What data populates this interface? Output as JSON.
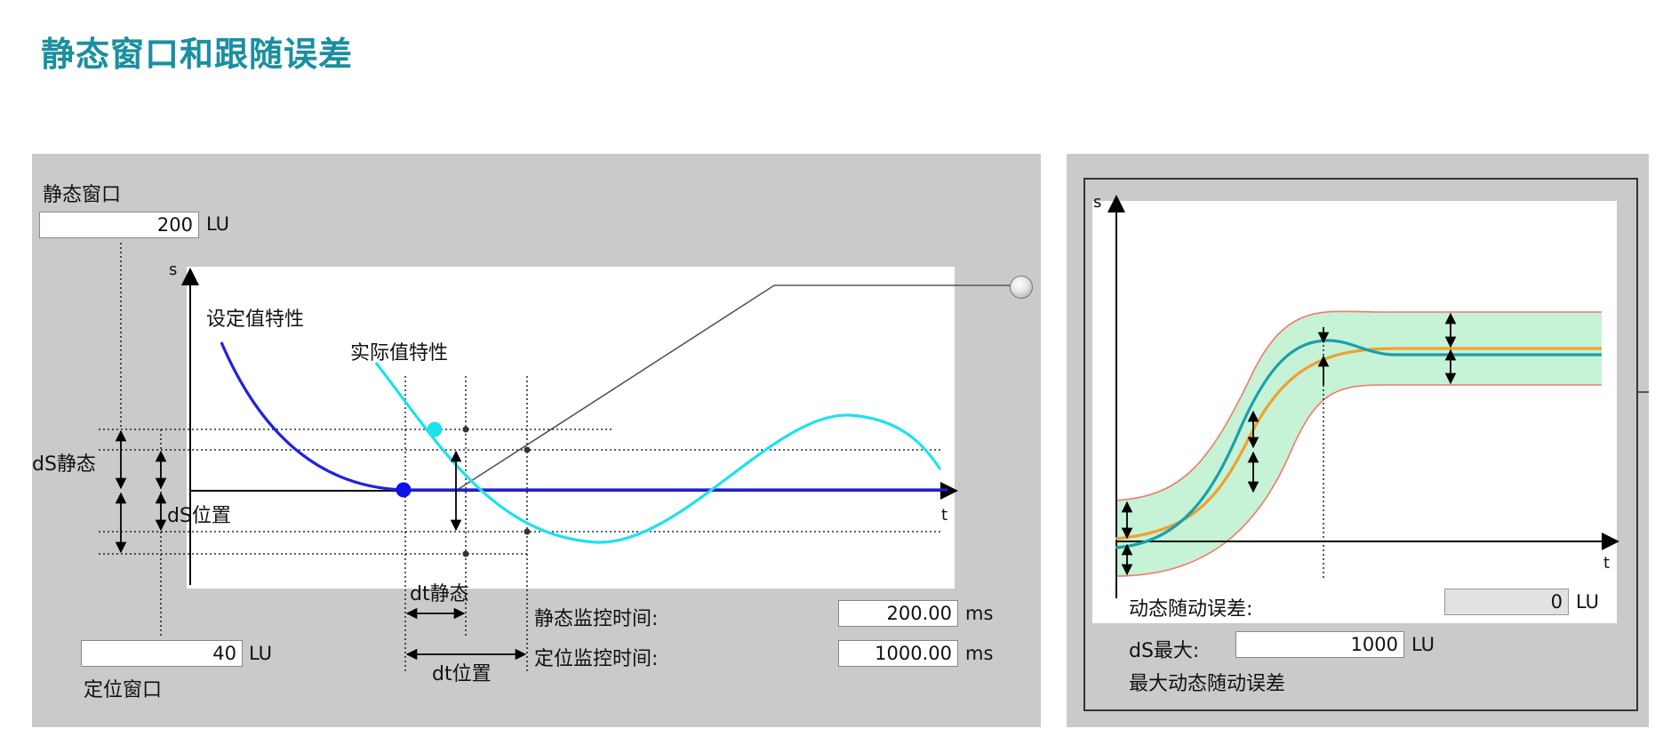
{
  "title": "静态窗口和跟随误差",
  "left": {
    "standstill_window": {
      "label": "静态窗口",
      "value": "200",
      "unit": "LU"
    },
    "position_window": {
      "label": "定位窗口",
      "value": "40",
      "unit": "LU"
    },
    "standstill_time": {
      "label": "静态监控时间:",
      "value": "200.00",
      "unit": "ms"
    },
    "position_time": {
      "label": "定位监控时间:",
      "value": "1000.00",
      "unit": "ms"
    },
    "axis_s": "s",
    "axis_t": "t",
    "setpoint_curve": "设定值特性",
    "actual_curve": "实际值特性",
    "ds_standstill": "dS静态",
    "ds_position": "dS位置",
    "dt_standstill": "dt静态",
    "dt_position": "dt位置"
  },
  "right": {
    "axis_s": "s",
    "axis_t": "t",
    "dynamic_error": {
      "label": "动态随动误差:",
      "value": "0",
      "unit": "LU"
    },
    "ds_max": {
      "label": "dS最大:",
      "value": "1000",
      "unit": "LU"
    },
    "max_dynamic_error": "最大动态随动误差"
  },
  "colors": {
    "title": "#1a8fa0",
    "setpoint": "#2222dd",
    "actual": "#1ee0ee",
    "tolerance_fill": "#c6f2d6",
    "tolerance_border": "#f07a6a",
    "orange": "#f0a030",
    "teal": "#1a9faa"
  }
}
